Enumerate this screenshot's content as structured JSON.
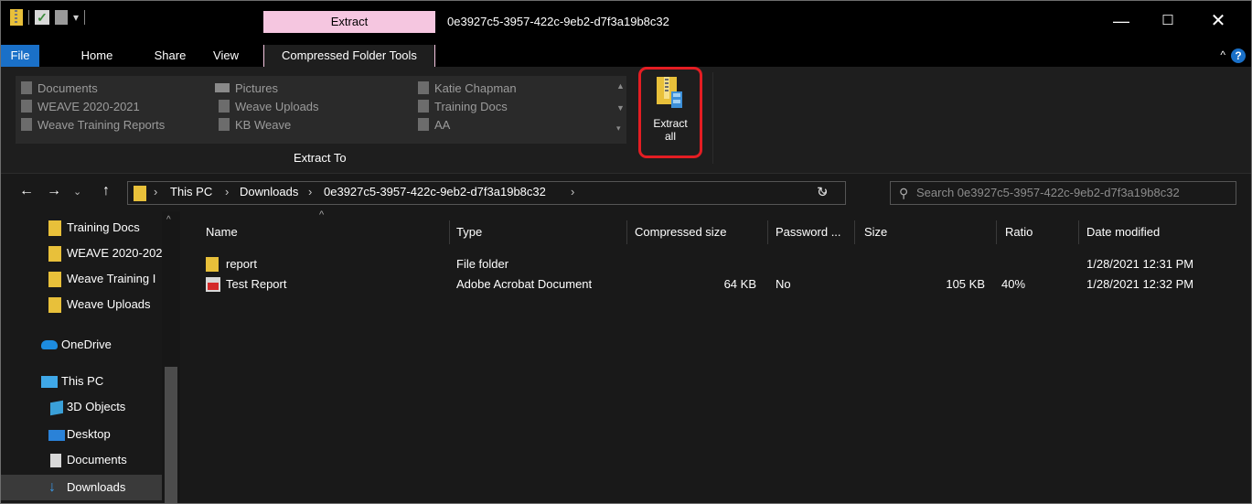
{
  "window": {
    "title": "0e3927c5-3957-422c-9eb2-d7f3a19b8c32",
    "context_tab": "Extract",
    "minimize": "—",
    "maximize": "☐",
    "close": "✕"
  },
  "ribbon_tabs": [
    "File",
    "Home",
    "Share",
    "View",
    "Compressed Folder Tools"
  ],
  "ribbon": {
    "gallery_items": [
      "Documents",
      "WEAVE 2020-2021",
      "Weave Training Reports",
      "Pictures",
      "Weave Uploads",
      "KB Weave",
      "Katie Chapman",
      "Training Docs",
      "AA"
    ],
    "group_label": "Extract To",
    "extract_all_line1": "Extract",
    "extract_all_line2": "all"
  },
  "address": {
    "crumbs": [
      "This PC",
      "Downloads",
      "0e3927c5-3957-422c-9eb2-d7f3a19b8c32"
    ],
    "search_placeholder": "Search 0e3927c5-3957-422c-9eb2-d7f3a19b8c32"
  },
  "nav_pane": {
    "items": [
      {
        "label": "Training Docs",
        "icon": "folder-icon"
      },
      {
        "label": "WEAVE 2020-202",
        "icon": "folder-icon"
      },
      {
        "label": "Weave Training I",
        "icon": "folder-icon"
      },
      {
        "label": "Weave Uploads",
        "icon": "folder-icon"
      },
      {
        "label": "OneDrive",
        "icon": "cloud-icon"
      },
      {
        "label": "This PC",
        "icon": "computer-icon"
      },
      {
        "label": "3D Objects",
        "icon": "cube-icon"
      },
      {
        "label": "Desktop",
        "icon": "desktop-icon"
      },
      {
        "label": "Documents",
        "icon": "documents-icon"
      },
      {
        "label": "Downloads",
        "icon": "download-arrow-icon"
      }
    ]
  },
  "file_list": {
    "columns": [
      "Name",
      "Type",
      "Compressed size",
      "Password ...",
      "Size",
      "Ratio",
      "Date modified"
    ],
    "rows": [
      {
        "name": "report",
        "type": "File folder",
        "compressed": "",
        "password": "",
        "size": "",
        "ratio": "",
        "date": "1/28/2021 12:31 PM",
        "icon": "folder-icon"
      },
      {
        "name": "Test Report",
        "type": "Adobe Acrobat Document",
        "compressed": "64 KB",
        "password": "No",
        "size": "105 KB",
        "ratio": "40%",
        "date": "1/28/2021 12:32 PM",
        "icon": "pdf-icon"
      }
    ]
  }
}
